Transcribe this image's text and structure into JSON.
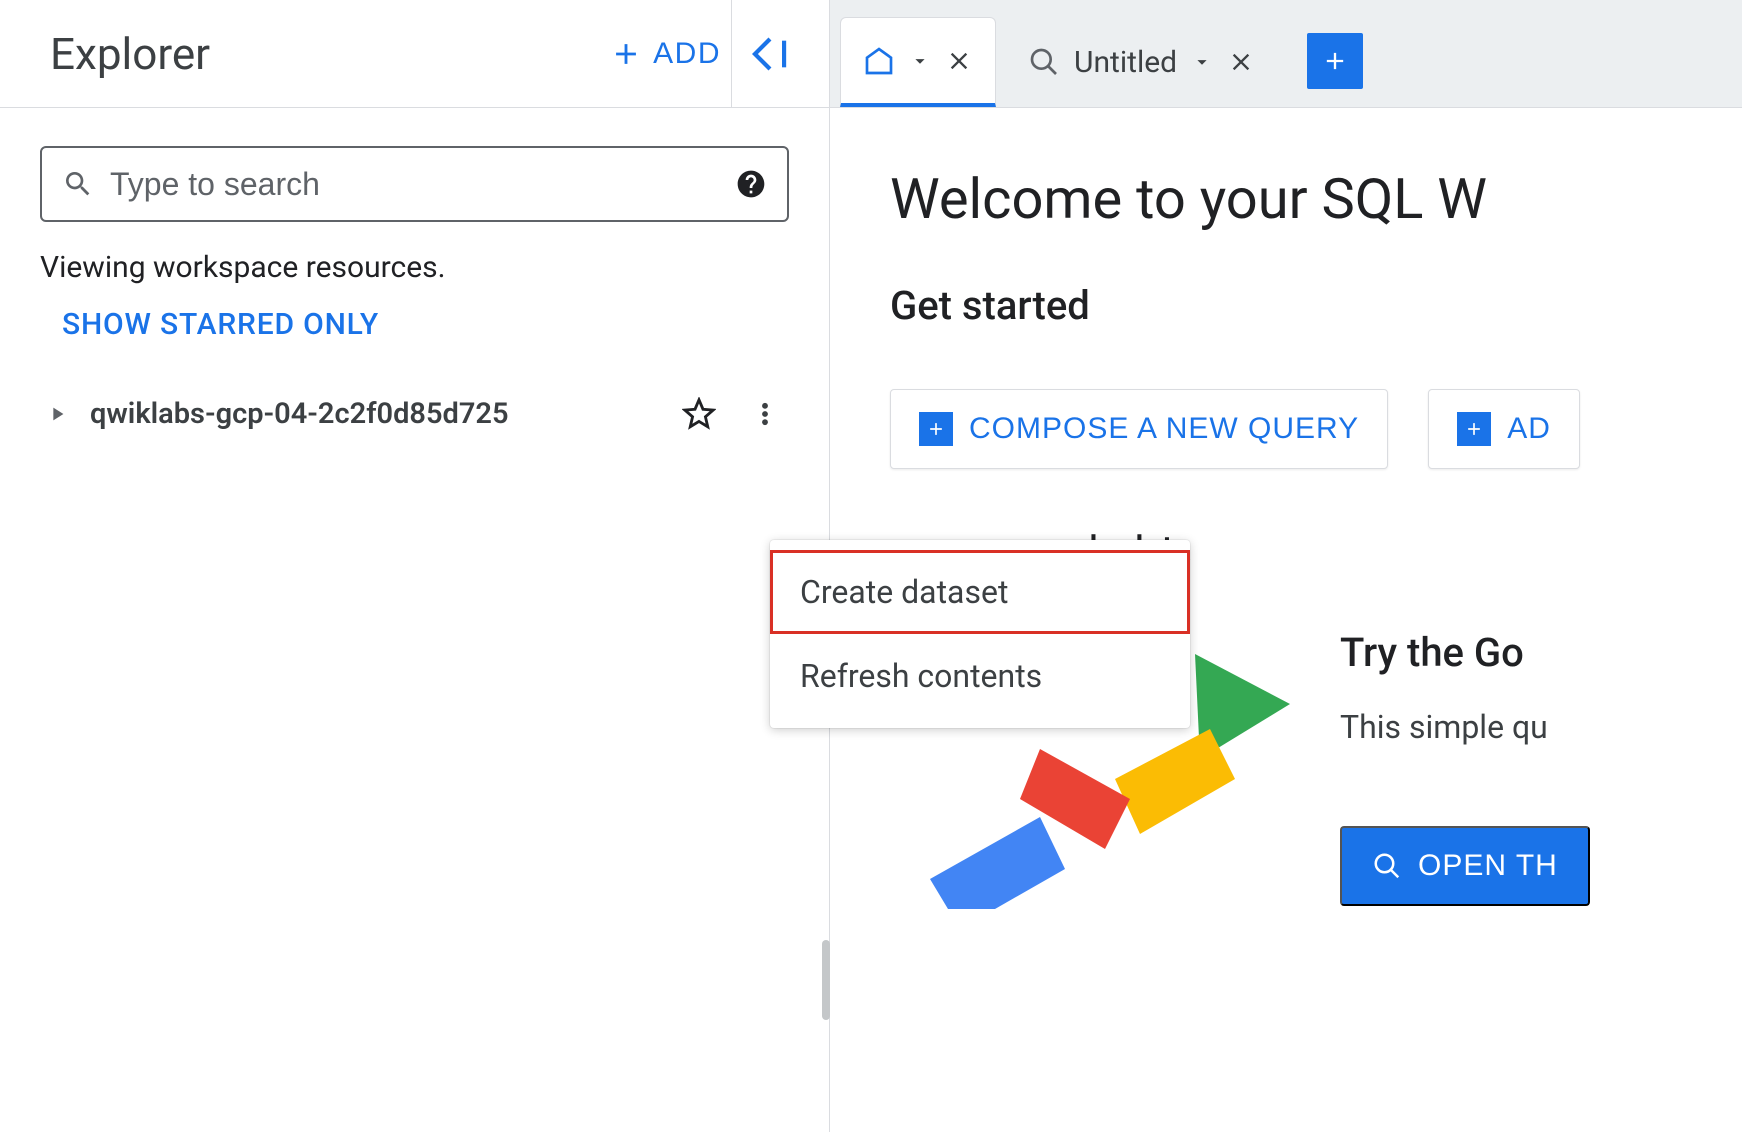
{
  "sidebar": {
    "title": "Explorer",
    "add_label": "ADD",
    "search_placeholder": "Type to search",
    "resource_note": "Viewing workspace resources.",
    "starred_link": "SHOW STARRED ONLY",
    "project_id": "qwiklabs-gcp-04-2c2f0d85d725"
  },
  "tabs": {
    "home_label": "",
    "untitled_label": "Untitled"
  },
  "main": {
    "welcome": "Welcome to your SQL W",
    "get_started": "Get started",
    "compose_query": "COMPOSE A NEW QUERY",
    "add_data": "AD",
    "sample_data": "ple data",
    "promo_title": "Try the Go",
    "promo_sub": "This simple qu",
    "open_btn": "OPEN TH"
  },
  "context_menu": {
    "create_dataset": "Create dataset",
    "refresh": "Refresh contents"
  }
}
